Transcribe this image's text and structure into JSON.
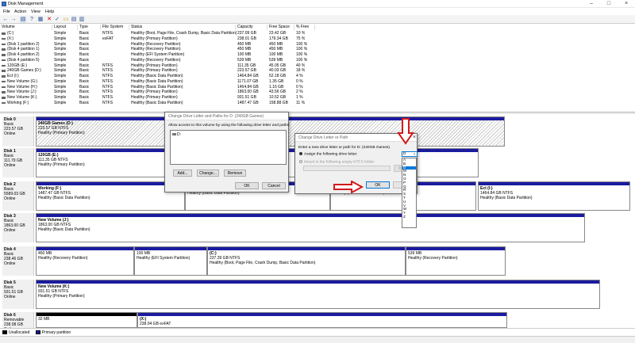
{
  "window": {
    "title": "Disk Management"
  },
  "menu": [
    "File",
    "Action",
    "View",
    "Help"
  ],
  "toolbar": [
    "back-icon",
    "forward-icon",
    "properties-icon",
    "help-icon",
    "refresh-icon",
    "delete-icon",
    "check-icon",
    "open-icon",
    "explore-icon",
    "settings-icon"
  ],
  "volume_list": {
    "columns": [
      "Volume",
      "Layout",
      "Type",
      "File System",
      "Status",
      "Capacity",
      "Free Space",
      "% Free"
    ],
    "rows": [
      [
        "(C:)",
        "Simple",
        "Basic",
        "NTFS",
        "Healthy (Boot, Page File, Crash Dump, Basic Data Partition)",
        "237.09 GB",
        "23.42 GB",
        "10 %"
      ],
      [
        "(X:)",
        "Simple",
        "Basic",
        "exFAT",
        "Healthy (Primary Partition)",
        "238.01 GB",
        "179.34 GB",
        "75 %"
      ],
      [
        "(Disk 1 partition 2)",
        "Simple",
        "Basic",
        "",
        "Healthy (Recovery Partition)",
        "450 MB",
        "450 MB",
        "100 %"
      ],
      [
        "(Disk 4 partition 1)",
        "Simple",
        "Basic",
        "",
        "Healthy (Recovery Partition)",
        "450 MB",
        "450 MB",
        "100 %"
      ],
      [
        "(Disk 4 partition 2)",
        "Simple",
        "Basic",
        "",
        "Healthy (EFI System Partition)",
        "100 MB",
        "100 MB",
        "100 %"
      ],
      [
        "(Disk 4 partition 5)",
        "Simple",
        "Basic",
        "",
        "Healthy (Recovery Partition)",
        "539 MB",
        "539 MB",
        "100 %"
      ],
      [
        "120GB (E:)",
        "Simple",
        "Basic",
        "NTFS",
        "Healthy (Primary Partition)",
        "111.35 GB",
        "45.05 GB",
        "40 %"
      ],
      [
        "240GB Games (D:)",
        "Simple",
        "Basic",
        "NTFS",
        "Healthy (Primary Partition)",
        "223.57 GB",
        "40.03 GB",
        "18 %"
      ],
      [
        "Ect (I:)",
        "Simple",
        "Basic",
        "NTFS",
        "Healthy (Basic Data Partition)",
        "1464.84 GB",
        "52.18 GB",
        "4 %"
      ],
      [
        "New Volume (G:)",
        "Simple",
        "Basic",
        "NTFS",
        "Healthy (Basic Data Partition)",
        "1171.07 GB",
        "1.35 GB",
        "0 %"
      ],
      [
        "New Volume (H:)",
        "Simple",
        "Basic",
        "NTFS",
        "Healthy (Basic Data Partition)",
        "1464.84 GB",
        "1.16 GB",
        "0 %"
      ],
      [
        "New Volume (J:)",
        "Simple",
        "Basic",
        "NTFS",
        "Healthy (Primary Partition)",
        "1863.00 GB",
        "43.56 GB",
        "2 %"
      ],
      [
        "New Volume (K:)",
        "Simple",
        "Basic",
        "NTFS",
        "Healthy (Primary Partition)",
        "931.51 GB",
        "10.52 GB",
        "1 %"
      ],
      [
        "Working (F:)",
        "Simple",
        "Basic",
        "NTFS",
        "Healthy (Basic Data Partition)",
        "1487.47 GB",
        "158.88 GB",
        "11 %"
      ]
    ]
  },
  "disks": [
    {
      "name": "Disk 0",
      "type": "Basic",
      "size": "223.57 GB",
      "state": "Online",
      "parts": [
        {
          "name": "240GB Games (D:)",
          "size": "223.57 GB NTFS",
          "status": "Healthy (Primary Partition)"
        }
      ]
    },
    {
      "name": "Disk 1",
      "type": "Basic",
      "size": "111.79 GB",
      "state": "Online",
      "parts": [
        {
          "name": "120GB (E:)",
          "size": "111.35 GB NTFS",
          "status": "Healthy (Primary Partition)"
        }
      ]
    },
    {
      "name": "Disk 2",
      "type": "Basic",
      "size": "5589.03 GB",
      "state": "Online",
      "parts": [
        {
          "name": "Working (F:)",
          "size": "1487.47 GB NTFS",
          "status": "Healthy (Basic Data Partition)"
        },
        {
          "name": "",
          "size": "1171.07 GB NTFS",
          "status": "Healthy (Basic Data Partition)"
        },
        {
          "name": "",
          "size": "1464.84 GB NTFS",
          "status": "Healthy (Basic Data Partition)"
        },
        {
          "name": "Ect (I:)",
          "size": "1464.84 GB NTFS",
          "status": "Healthy (Basic Data Partition)"
        }
      ]
    },
    {
      "name": "Disk 3",
      "type": "Basic",
      "size": "1863.00 GB",
      "state": "Online",
      "parts": [
        {
          "name": "New Volume (J:)",
          "size": "1863.00 GB NTFS",
          "status": "Healthy (Basic Data Partition)"
        }
      ]
    },
    {
      "name": "Disk 4",
      "type": "Basic",
      "size": "238.46 GB",
      "state": "Online",
      "parts": [
        {
          "name": "",
          "size": "450 MB",
          "status": "Healthy (Recovery Partition)"
        },
        {
          "name": "",
          "size": "100 MB",
          "status": "Healthy (EFI System Partition)"
        },
        {
          "name": "(C:)",
          "size": "237.39 GB NTFS",
          "status": "Healthy (Boot, Page File, Crash Dump, Basic Data Partition)"
        },
        {
          "name": "",
          "size": "539 MB",
          "status": "Healthy (Recovery Partition)"
        }
      ]
    },
    {
      "name": "Disk 5",
      "type": "Basic",
      "size": "931.51 GB",
      "state": "Online",
      "parts": [
        {
          "name": "New Volume (K:)",
          "size": "931.51 GB NTFS",
          "status": "Healthy (Primary Partition)"
        }
      ]
    },
    {
      "name": "Disk 6",
      "type": "Removable",
      "size": "238.08 GB",
      "state": "Online",
      "parts": [
        {
          "name": "",
          "size": "32 MB",
          "status": ""
        },
        {
          "name": "(X:)",
          "size": "238.04 GB exFAT",
          "status": ""
        }
      ]
    }
  ],
  "legend": {
    "unallocated": "Unallocated",
    "primary": "Primary partition"
  },
  "dialog_paths": {
    "title": "Change Drive Letter and Paths for D: (240GB Games)",
    "instruction": "Allow access to this volume by using the following drive letter and paths:",
    "entry": "D:",
    "add": "Add...",
    "change": "Change...",
    "remove": "Remove",
    "ok": "OK",
    "cancel": "Cancel"
  },
  "dialog_letter": {
    "title": "Change Drive Letter or Path",
    "instruction": "Enter a new drive letter or path for D: (240GB Games).",
    "assign": "Assign the following drive letter:",
    "mount": "Mount in the following empty NTFS folder:",
    "browse": "Br...",
    "ok": "OK",
    "selected_letter": "D",
    "letters": [
      "A",
      "B",
      "D",
      "M",
      "N",
      "O",
      "P",
      "Q",
      "R",
      "S",
      "T",
      "U",
      "V",
      "W",
      "Y",
      "Z"
    ],
    "highlighted": "D"
  },
  "colors": {
    "primary": "#1b1ba0",
    "unallocated": "#000000",
    "arrow": "#d21b1b",
    "selection": "#0078d7"
  }
}
